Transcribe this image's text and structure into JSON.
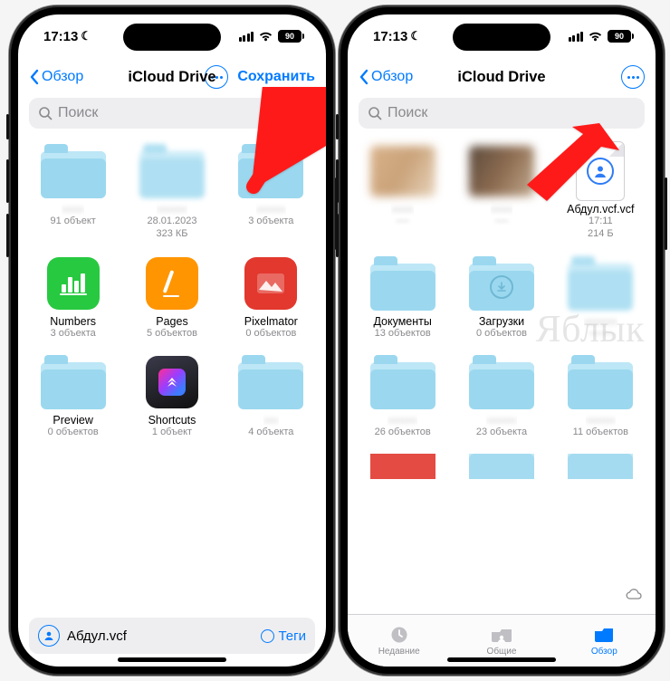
{
  "watermark": "Яблык",
  "status": {
    "time": "17:13",
    "battery": "90"
  },
  "phone_left": {
    "back_label": "Обзор",
    "title": "iCloud Drive",
    "save_label": "Сохранить",
    "search_placeholder": "Поиск",
    "items": [
      {
        "type": "folder",
        "name_hidden": true,
        "sub": "91 объект"
      },
      {
        "type": "folder",
        "blur": true,
        "name_hidden": true,
        "sub": "28.01.2023",
        "sub2": "323 КБ"
      },
      {
        "type": "folder",
        "name_hidden": true,
        "sub": "3 объекта"
      },
      {
        "type": "app",
        "app": "numbers",
        "name": "Numbers",
        "sub": "3 объекта"
      },
      {
        "type": "app",
        "app": "pages",
        "name": "Pages",
        "sub": "5 объектов"
      },
      {
        "type": "app",
        "app": "pixelmator",
        "name": "Pixelmator",
        "sub": "0 объектов"
      },
      {
        "type": "folder",
        "name": "Preview",
        "sub": "0 объектов"
      },
      {
        "type": "app",
        "app": "shortcuts",
        "name": "Shortcuts",
        "sub": "1 объект"
      },
      {
        "type": "folder",
        "name_hidden": true,
        "sub": "4 объекта"
      }
    ],
    "bottom_file": {
      "name": "Абдул.vcf",
      "tags_label": "Теги"
    }
  },
  "phone_right": {
    "back_label": "Обзор",
    "title": "iCloud Drive",
    "search_placeholder": "Поиск",
    "items_row1": [
      {
        "type": "img",
        "variant": "tb1",
        "name_hidden": true
      },
      {
        "type": "img",
        "variant": "tb2",
        "name_hidden": true
      },
      {
        "type": "file",
        "name": "Абдул.vcf.vcf",
        "sub": "17:11",
        "sub2": "214 Б"
      }
    ],
    "items": [
      {
        "type": "folder",
        "name": "Документы",
        "sub": "13 объектов"
      },
      {
        "type": "folder",
        "badge": "download",
        "name": "Загрузки",
        "sub": "0 объектов"
      },
      {
        "type": "folder",
        "blur": true,
        "name_hidden": true,
        "sub_hidden": true
      },
      {
        "type": "folder",
        "name_hidden": true,
        "sub": "26 объектов"
      },
      {
        "type": "folder",
        "name_hidden": true,
        "sub": "23 объекта"
      },
      {
        "type": "folder",
        "name_hidden": true,
        "sub": "11 объектов"
      }
    ],
    "tabs": {
      "recent": "Недавние",
      "shared": "Общие",
      "browse": "Обзор"
    }
  }
}
